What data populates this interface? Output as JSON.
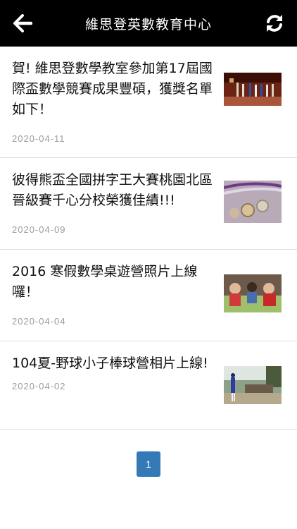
{
  "header": {
    "title": "維思登英數教育中心",
    "back_icon": "arrow-left-icon",
    "refresh_icon": "refresh-icon"
  },
  "articles": [
    {
      "title": "賀! 維思登數學教室參加第17屆國際盃數學競賽成果豐碩，獲獎名單如下！",
      "date": "2020-04-11"
    },
    {
      "title": "彼得熊盃全國拼字王大賽桃園北區晉級賽千心分校榮獲佳績!!!",
      "date": "2020-04-09"
    },
    {
      "title": "2016 寒假數學桌遊營照片上線囉！",
      "date": "2020-04-04"
    },
    {
      "title": "104夏-野球小子棒球營相片上線!",
      "date": "2020-04-02"
    }
  ],
  "pagination": {
    "current": "1"
  }
}
